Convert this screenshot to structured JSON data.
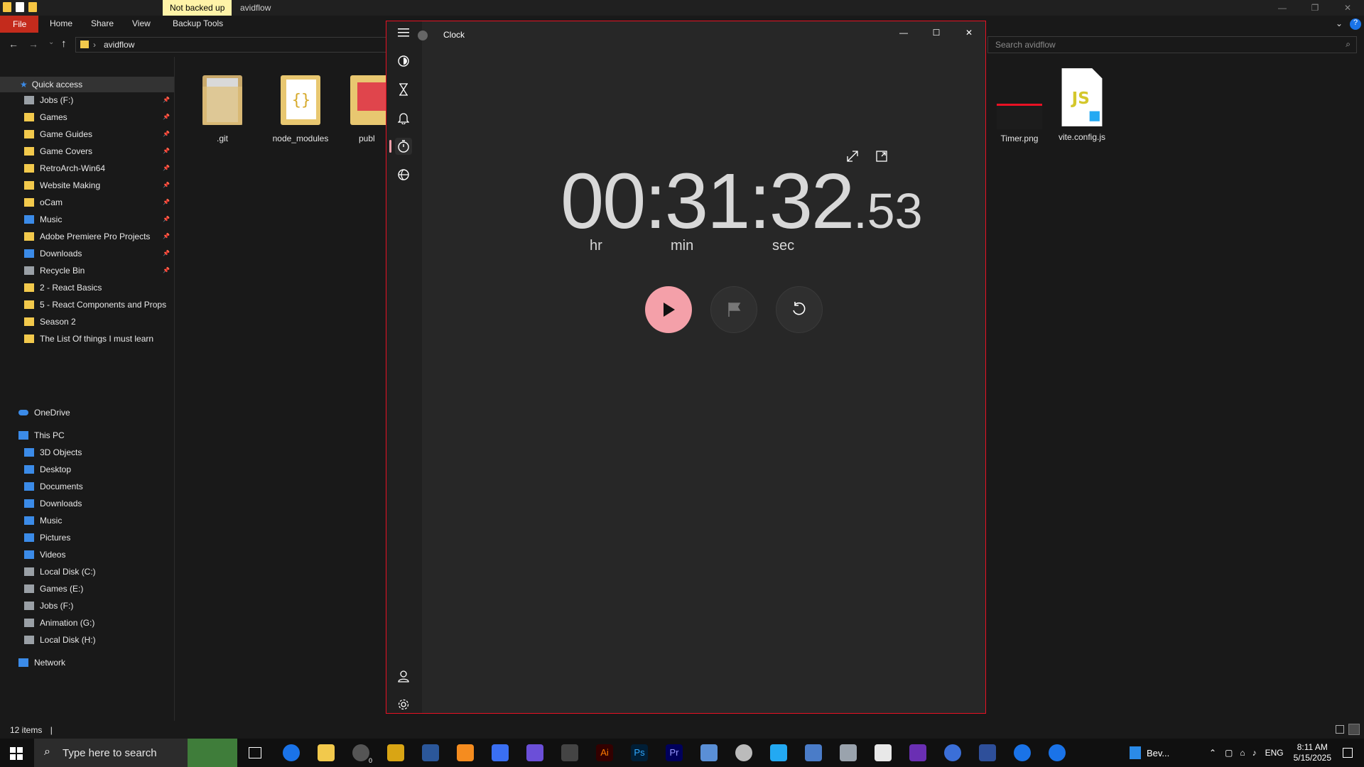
{
  "explorer": {
    "title": "avidflow",
    "not_backed_up": "Not backed up",
    "tabs": {
      "file": "File",
      "home": "Home",
      "share": "Share",
      "view": "View",
      "backup": "Backup Tools"
    },
    "address": "avidflow",
    "search_placeholder": "Search avidflow",
    "quick_access": "Quick access",
    "quick_items": [
      {
        "label": "Jobs (F:)",
        "icon": "drive-icon"
      },
      {
        "label": "Games",
        "icon": "folder-icon"
      },
      {
        "label": "Game Guides",
        "icon": "folder-icon"
      },
      {
        "label": "Game Covers",
        "icon": "folder-icon"
      },
      {
        "label": "RetroArch-Win64",
        "icon": "folder-icon"
      },
      {
        "label": "Website Making",
        "icon": "folder-icon"
      },
      {
        "label": "oCam",
        "icon": "folder-icon"
      },
      {
        "label": "Music",
        "icon": "music-icon"
      },
      {
        "label": "Adobe Premiere Pro Projects",
        "icon": "folder-icon"
      },
      {
        "label": "Downloads",
        "icon": "download-icon"
      },
      {
        "label": "Recycle Bin",
        "icon": "recycle-bin-icon"
      },
      {
        "label": "2 - React Basics",
        "icon": "folder-icon"
      },
      {
        "label": "5 - React Components and Props",
        "icon": "folder-icon"
      },
      {
        "label": "Season 2",
        "icon": "folder-icon"
      },
      {
        "label": "The List Of things I must learn",
        "icon": "folder-icon"
      }
    ],
    "onedrive": "OneDrive",
    "this_pc": "This PC",
    "pc_items": [
      {
        "label": "3D Objects"
      },
      {
        "label": "Desktop"
      },
      {
        "label": "Documents"
      },
      {
        "label": "Downloads"
      },
      {
        "label": "Music"
      },
      {
        "label": "Pictures"
      },
      {
        "label": "Videos"
      },
      {
        "label": "Local Disk (C:)"
      },
      {
        "label": "Games (E:)"
      },
      {
        "label": "Jobs (F:)"
      },
      {
        "label": "Animation (G:)"
      },
      {
        "label": "Local Disk (H:)"
      }
    ],
    "network": "Network",
    "files": [
      {
        "name": ".git"
      },
      {
        "name": "node_modules"
      },
      {
        "name": "publ"
      },
      {
        "name": "Timer.png"
      },
      {
        "name": "vite.config.js"
      }
    ],
    "status": "12 items"
  },
  "clock": {
    "title": "Clock",
    "hours": "00",
    "minutes": "31",
    "seconds": "32",
    "hundredths": "53",
    "colon": ":",
    "dot": ".",
    "unit_hr": "hr",
    "unit_min": "min",
    "unit_sec": "sec",
    "accent": "#f4a0a9"
  },
  "taskbar": {
    "search_placeholder": "Type here to search",
    "pinned_label": "Bev...",
    "lang": "ENG",
    "time": "8:11 AM",
    "date": "5/15/2025",
    "badge": "0"
  }
}
